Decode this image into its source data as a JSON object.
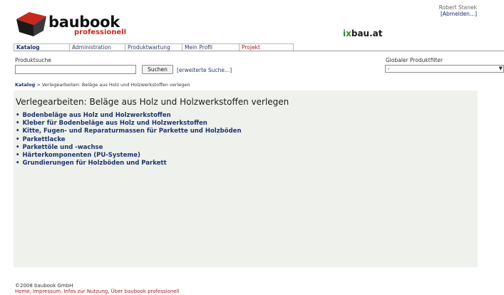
{
  "logo": {
    "name": "baubook",
    "sub": "professionell"
  },
  "partner": {
    "prefix": "ix",
    "suffix": "bau.at"
  },
  "user": {
    "name": "Robert Stanek",
    "logout": "[Abmelden...]"
  },
  "tabs": [
    {
      "label": "Katalog"
    },
    {
      "label": "Administration"
    },
    {
      "label": "Produktwartung"
    },
    {
      "label": "Mein Profil"
    },
    {
      "label": "Projekt"
    }
  ],
  "search": {
    "label": "Produktsuche",
    "value": "",
    "button": "Suchen",
    "advanced": "[erweiterte Suche...]"
  },
  "filter": {
    "label": "Globaler Produktfilter",
    "selected": "-"
  },
  "breadcrumb": {
    "root": "Katalog",
    "separator": " > ",
    "current": "Verlegearbeiten: Beläge aus Holz und Holzwerkstoffen verlegen"
  },
  "page": {
    "title": "Verlegearbeiten: Beläge aus Holz und Holzwerkstoffen verlegen"
  },
  "categories": [
    "Bodenbeläge aus Holz und Holzwerkstoffen",
    "Kleber für Bodenbeläge aus Holz und Holzwerkstoffen",
    "Kitte, Fugen- und Reparaturmassen für Parkette und Holzböden",
    "Parkettlacke",
    "Parkettöle und -wachse",
    "Härterkomponenten (PU-Systeme)",
    "Grundierungen für Holzböden und Parkett"
  ],
  "footer": {
    "copyright": "©2008 baubook GmbH",
    "links": "Home, Impressum, Infos zur Nutzung, Über baubook professionell"
  },
  "colors": {
    "accent_red": "#c8281e",
    "link_blue": "#1f3470",
    "content_bg": "#eef1ec",
    "partner_green": "#2e8b2e"
  }
}
